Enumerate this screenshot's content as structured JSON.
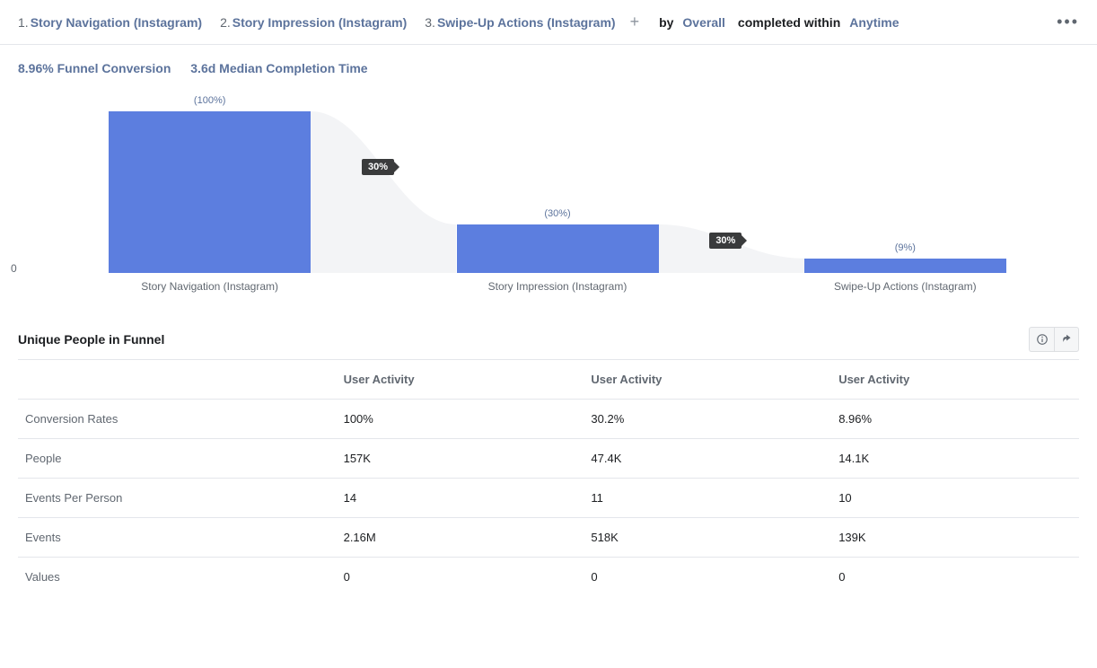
{
  "header": {
    "steps": [
      {
        "num": "1.",
        "label": "Story Navigation (Instagram)"
      },
      {
        "num": "2.",
        "label": "Story Impression (Instagram)"
      },
      {
        "num": "3.",
        "label": "Swipe-Up Actions (Instagram)"
      }
    ],
    "by_label": "by",
    "by_value": "Overall",
    "completed_label": "completed within",
    "completed_value": "Anytime"
  },
  "metrics": {
    "conversion": "8.96% Funnel Conversion",
    "median_time": "3.6d Median Completion Time"
  },
  "chart_data": {
    "type": "bar",
    "title": "",
    "xlabel": "",
    "ylabel": "",
    "ylim": [
      0,
      100
    ],
    "categories": [
      "Story Navigation (Instagram)",
      "Story Impression (Instagram)",
      "Swipe-Up Actions (Instagram)"
    ],
    "values": [
      100,
      30,
      9
    ],
    "value_labels": [
      "(100%)",
      "(30%)",
      "(9%)"
    ],
    "drop_labels": [
      "30%",
      "30%"
    ],
    "axis_zero": "0"
  },
  "table": {
    "title": "Unique People in Funnel",
    "columns": [
      "User Activity",
      "User Activity",
      "User Activity"
    ],
    "rows": [
      {
        "label": "Conversion Rates",
        "cells": [
          "100%",
          "30.2%",
          "8.96%"
        ]
      },
      {
        "label": "People",
        "cells": [
          "157K",
          "47.4K",
          "14.1K"
        ]
      },
      {
        "label": "Events Per Person",
        "cells": [
          "14",
          "11",
          "10"
        ]
      },
      {
        "label": "Events",
        "cells": [
          "2.16M",
          "518K",
          "139K"
        ]
      },
      {
        "label": "Values",
        "cells": [
          "0",
          "0",
          "0"
        ]
      }
    ]
  }
}
